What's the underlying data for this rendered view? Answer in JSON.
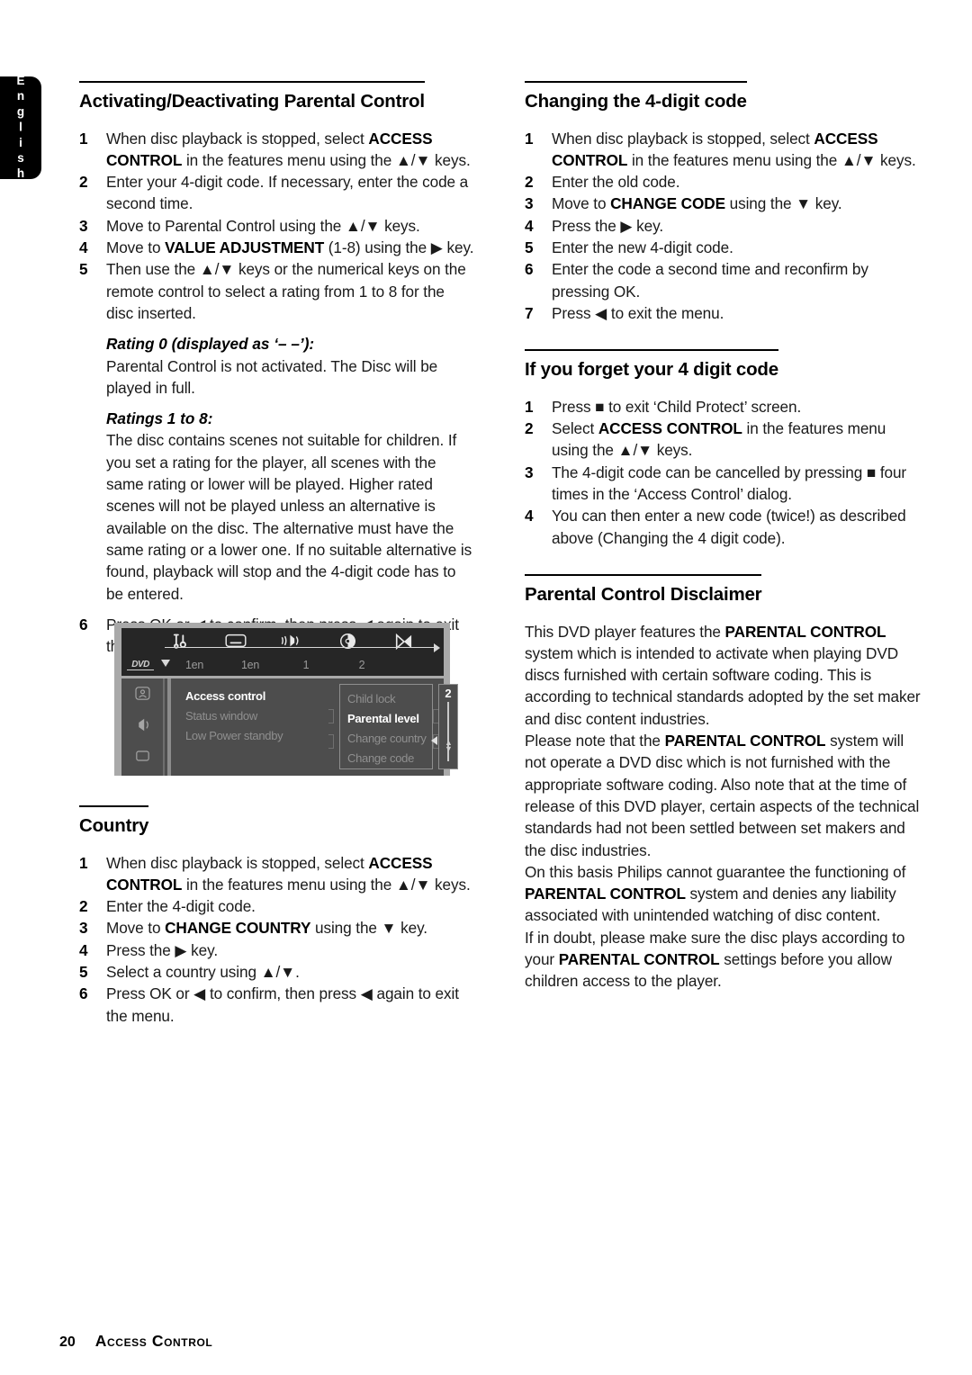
{
  "language_tab": {
    "label": "English"
  },
  "footer": {
    "page_number": "20",
    "title": "Access Control"
  },
  "left_column": {
    "section1": {
      "heading": "Activating/Deactivating Parental Control",
      "steps": [
        {
          "num": "1",
          "html": "When disc playback is stopped, select <b>ACCESS CONTROL</b> in the features menu using the ▲/▼ keys."
        },
        {
          "num": "2",
          "html": "Enter your 4-digit code. If necessary, enter the code a second time."
        },
        {
          "num": "3",
          "html": "Move to Parental Control using the ▲/▼ keys."
        },
        {
          "num": "4",
          "html": "Move to <b>VALUE ADJUSTMENT</b> (1-8) using the ▶ key."
        },
        {
          "num": "5",
          "html": "Then use the ▲/▼ keys or the numerical keys on the remote control to select a rating from 1 to 8 for the disc inserted."
        }
      ],
      "rating0_heading": "Rating 0 (displayed as ‘– –’):",
      "rating0_body": "Parental Control is not activated. The Disc will be played in full.",
      "ratings18_heading": "Ratings 1 to 8:",
      "ratings18_body": "The disc contains scenes not suitable for children. If you set a rating for the player, all scenes with the same rating or lower will be played. Higher rated scenes will not be played unless an alternative is available on the disc. The alternative must have the same rating or a lower one. If no suitable alternative is found, playback will stop and the 4-digit code has to be entered.",
      "step6": {
        "num": "6",
        "html": "Press OK or ◀ to confirm, then press ◀ again to exit the menu."
      }
    },
    "osd_figure": {
      "topbar_values": [
        "1en",
        "1en",
        "1",
        "2"
      ],
      "disc_label": "DVD",
      "menu_items": [
        {
          "label": "Access control",
          "selected": true
        },
        {
          "label": "Status window",
          "selected": false
        },
        {
          "label": "Low Power standby",
          "selected": false
        }
      ],
      "submenu_items": [
        {
          "label": "Child lock",
          "selected": false
        },
        {
          "label": "Parental level",
          "selected": true
        },
        {
          "label": "Change country",
          "selected": false
        },
        {
          "label": "Change code",
          "selected": false
        }
      ],
      "slider_value": "2"
    },
    "section2": {
      "heading": "Country",
      "steps": [
        {
          "num": "1",
          "html": "When disc playback is stopped, select <b>ACCESS CONTROL</b> in the features menu using the ▲/▼ keys."
        },
        {
          "num": "2",
          "html": "Enter the 4-digit code."
        },
        {
          "num": "3",
          "html": "Move to <b>CHANGE COUNTRY</b> using the ▼ key."
        },
        {
          "num": "4",
          "html": "Press the ▶ key."
        },
        {
          "num": "5",
          "html": "Select a country using ▲/▼."
        },
        {
          "num": "6",
          "html": "Press OK or ◀ to confirm, then press ◀ again to exit the menu."
        }
      ]
    }
  },
  "right_column": {
    "section1": {
      "heading": "Changing the 4-digit code",
      "steps": [
        {
          "num": "1",
          "html": "When disc playback is stopped, select <b>ACCESS CONTROL</b> in the features menu using the ▲/▼ keys."
        },
        {
          "num": "2",
          "html": "Enter the old code."
        },
        {
          "num": "3",
          "html": "Move to <b>CHANGE CODE</b> using the ▼ key."
        },
        {
          "num": "4",
          "html": "Press the ▶ key."
        },
        {
          "num": "5",
          "html": "Enter the new 4-digit code."
        },
        {
          "num": "6",
          "html": "Enter the code a second time and reconfirm by pressing OK."
        },
        {
          "num": "7",
          "html": "Press ◀ to exit the menu."
        }
      ]
    },
    "section2": {
      "heading": "If you forget your 4 digit code",
      "steps": [
        {
          "num": "1",
          "html": "Press ■ to exit ‘Child Protect’ screen."
        },
        {
          "num": "2",
          "html": "Select <b>ACCESS CONTROL</b> in the features menu using the ▲/▼ keys."
        },
        {
          "num": "3",
          "html": "The 4-digit code can be cancelled by pressing ■ four times in the ‘Access Control’ dialog."
        },
        {
          "num": "4",
          "html": "You can then enter a new code (twice!) as described above (Changing the 4 digit code)."
        }
      ]
    },
    "section3": {
      "heading": "Parental Control Disclaimer",
      "paragraphs": [
        "This DVD player features the <b>PARENTAL CONTROL</b> system which is intended to activate when playing DVD discs furnished with certain software coding. This is according to technical standards adopted by the set maker and disc content industries.",
        "Please note that the <b>PARENTAL CONTROL</b> system will not operate a DVD disc which is not furnished with the appropriate software coding. Also note that at the time of release of this DVD player, certain aspects of the technical standards had not been settled between set makers and the disc industries.",
        "On this basis Philips cannot guarantee the functioning of <b>PARENTAL CONTROL</b> system and denies any liability associated with unintended watching of disc content.",
        "If in doubt, please make sure the disc plays according to your <b>PARENTAL CONTROL</b> settings before you allow children access to the player."
      ]
    }
  }
}
